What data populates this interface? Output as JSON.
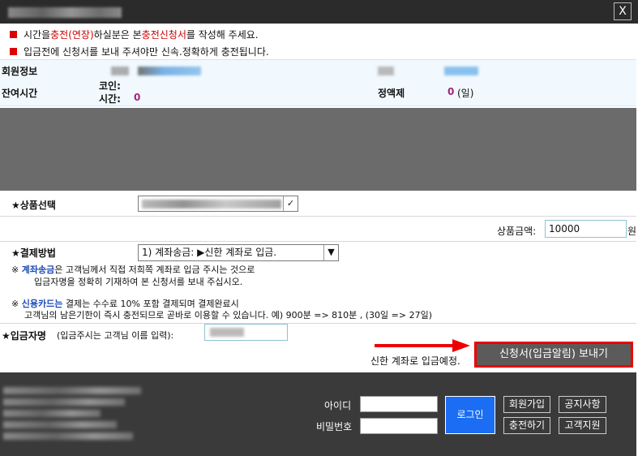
{
  "window": {
    "close_label": "X"
  },
  "notices": {
    "n1_pre": "시간을 ",
    "n1_red1": "충전(연장)",
    "n1_mid": "하실분은  본  ",
    "n1_red2": "충전신청서",
    "n1_post": "를 작성해 주세요.",
    "n2": "입금전에 신청서를 보내 주셔야만 신속.정확하게 충전됩니다."
  },
  "member": {
    "info_label": "회원정보",
    "remaining_label": "잔여시간",
    "coin_label": "코인:",
    "time_label": "시간:",
    "time_value": "0",
    "flat_label": "정액제",
    "flat_value": "0",
    "flat_unit": "(일)"
  },
  "product": {
    "label": "★상품선택",
    "price_label": "상품금액:",
    "price_value": "10000",
    "price_unit": "원"
  },
  "payment": {
    "label": "★결제방법",
    "selected": "1) 계좌송금: ▶신한 계좌로 입금."
  },
  "desc": {
    "d1_prefix": "※ ",
    "d1_bold": "계좌송금",
    "d1_rest": "은 고객님께서  직접 저희쪽 계좌로 입금 주시는 것으로",
    "d1_line2": "입금자명을 정확히 기재하여   본  신청서를  보내 주십시오.",
    "d2_prefix": "※ ",
    "d2_bold": "신용카드는",
    "d2_rest": " 결제는 수수료 10% 포함 결제되며 결제완료시",
    "d2_line2": "고객님의 남은기한이 즉시 충전되므로 곧바로 이용할 수 있습니다. 예) 900분 => 810분 , (30일 => 27일)"
  },
  "depositor": {
    "label": "★입금자명",
    "hint": "(입금주시는 고객님 이름 입력):"
  },
  "submit": {
    "status": "신한 계좌로 입금예정.",
    "button": "신청서(입금알림) 보내기"
  },
  "footer": {
    "id_label": "아이디",
    "pw_label": "비밀번호",
    "login": "로그인",
    "join": "회원가입",
    "notice": "공지사항",
    "charge": "충전하기",
    "support": "고객지원"
  },
  "colors": {
    "accent_red": "#e00000",
    "login_blue": "#1b6ef3",
    "value_pink": "#a0267d"
  }
}
